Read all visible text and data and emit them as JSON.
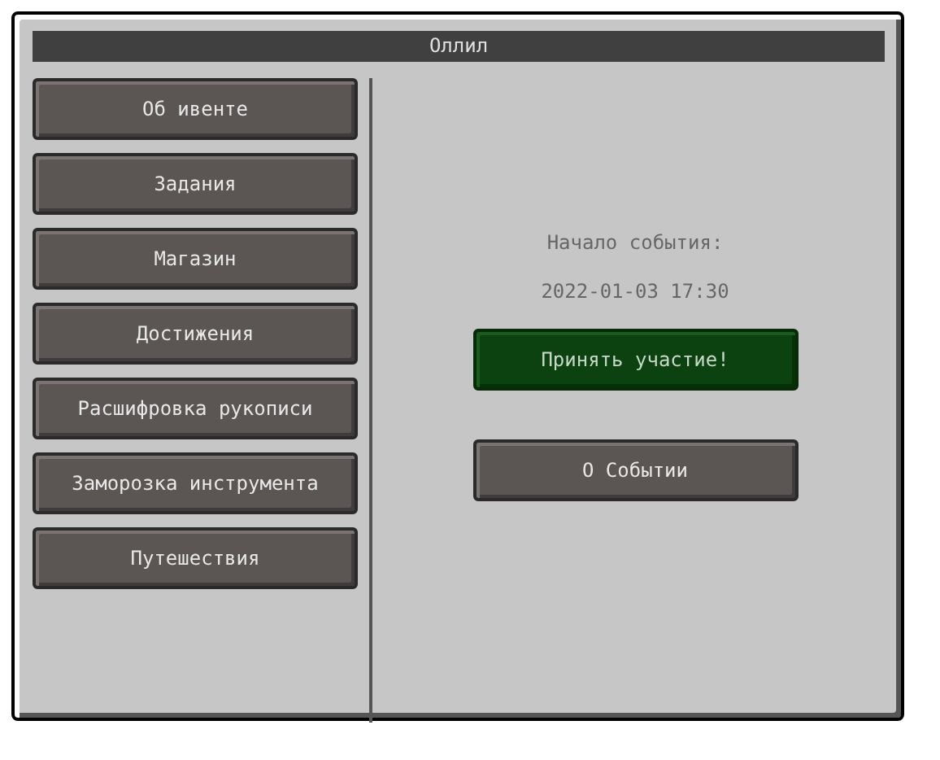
{
  "window": {
    "title": "Оллил"
  },
  "menu": [
    "Об ивенте",
    "Задания",
    "Магазин",
    "Достижения",
    "Расшифровка рукописи",
    "Заморозка инструмента",
    "Путешествия"
  ],
  "event": {
    "start_label": "Начало события:",
    "start_time": "2022-01-03 17:30",
    "buttons": [
      {
        "label": "Принять участие!",
        "kind": "primary"
      },
      {
        "label": "О Событии",
        "kind": "default"
      }
    ]
  }
}
